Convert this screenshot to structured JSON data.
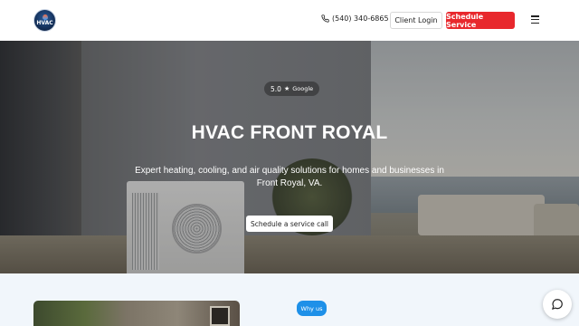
{
  "header": {
    "logo_text": "HVAC",
    "phone": "(540) 340-6865",
    "client_login_label": "Client Login",
    "schedule_label": "Schedule Service"
  },
  "hero": {
    "rating_value": "5.0",
    "rating_source": "Google",
    "title": "HVAC FRONT ROYAL",
    "subtitle": "Expert heating, cooling, and air quality solutions for homes and businesses in Front Royal, VA.",
    "cta_label": "Schedule a service call"
  },
  "section2": {
    "badge_label": "Why us"
  },
  "colors": {
    "accent_red": "#e8282d",
    "badge_blue": "#1e90e8"
  },
  "icons": [
    "phone-icon",
    "menu-icon",
    "star-icon",
    "chat-icon"
  ]
}
